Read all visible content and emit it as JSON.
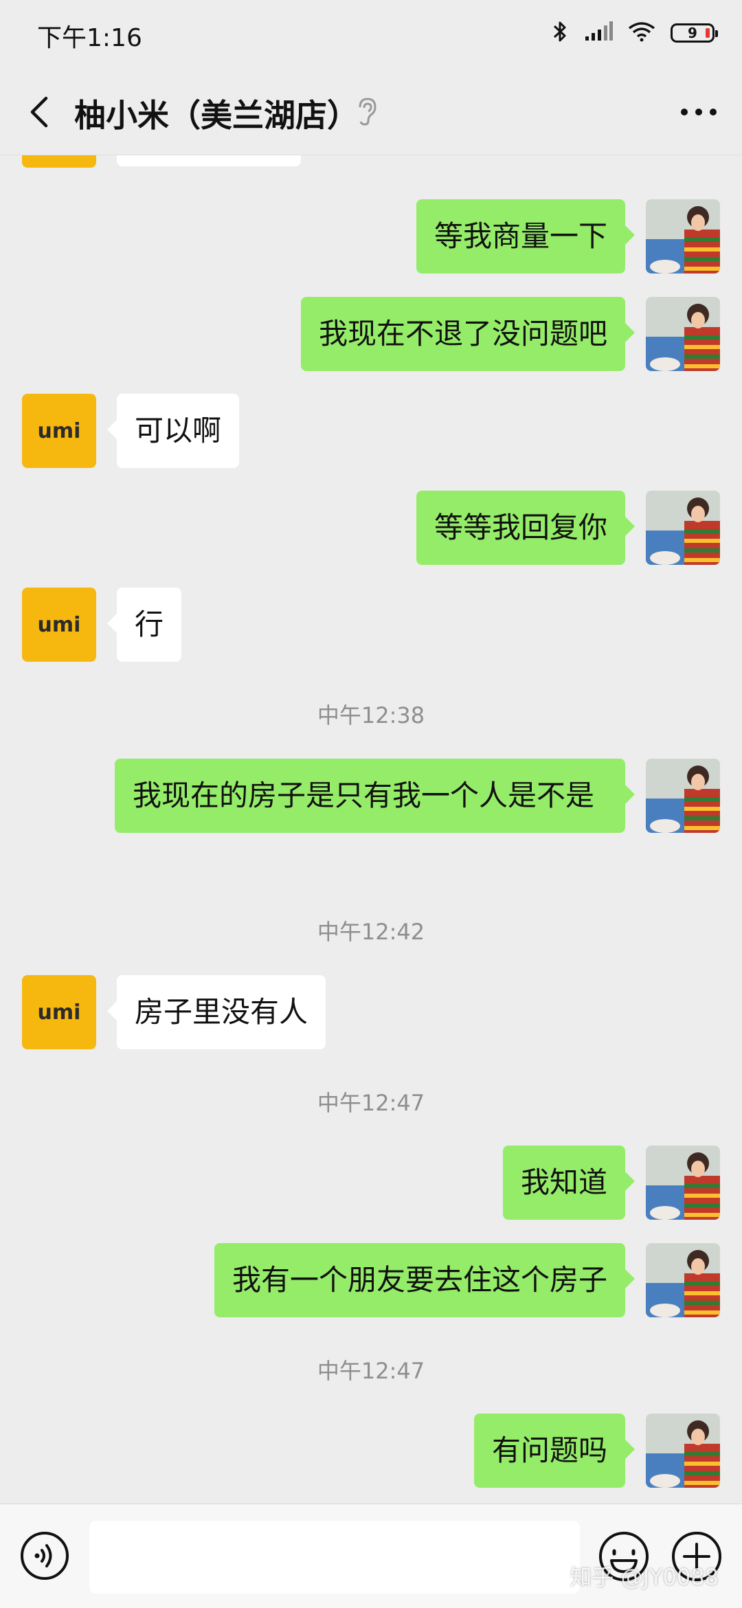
{
  "status_bar": {
    "time": "下午1:16",
    "battery": "9"
  },
  "header": {
    "title": "柚小米（美兰湖店）"
  },
  "contact": {
    "avatar_text": "umi",
    "brand_color": "#f6b70f"
  },
  "messages": [
    {
      "side": "in",
      "text": ""
    },
    {
      "side": "out",
      "text": "等我商量一下"
    },
    {
      "side": "out",
      "text": "我现在不退了没问题吧"
    },
    {
      "side": "in",
      "text": "可以啊"
    },
    {
      "side": "out",
      "text": "等等我回复你"
    },
    {
      "side": "in",
      "text": "行"
    },
    {
      "side": "time",
      "text": "中午12:38"
    },
    {
      "side": "out",
      "text": "我现在的房子是只有我一个人是不是"
    },
    {
      "side": "time",
      "text": "中午12:42"
    },
    {
      "side": "in",
      "text": "房子里没有人"
    },
    {
      "side": "time",
      "text": "中午12:47"
    },
    {
      "side": "out",
      "text": "我知道"
    },
    {
      "side": "out",
      "text": "我有一个朋友要去住这个房子"
    },
    {
      "side": "time",
      "text": "中午12:47"
    },
    {
      "side": "out",
      "text": "有问题吗"
    }
  ],
  "colors": {
    "outgoing_bubble": "#95ec69",
    "incoming_bubble": "#ffffff",
    "background": "#ededed"
  },
  "icons": {
    "back": "chevron-left-icon",
    "ear": "ear-icon",
    "more": "more-icon",
    "voice": "voice-icon",
    "emoji": "emoji-icon",
    "plus": "plus-icon"
  },
  "input": {
    "value": "",
    "placeholder": ""
  },
  "watermark": "知乎 @JY0088"
}
